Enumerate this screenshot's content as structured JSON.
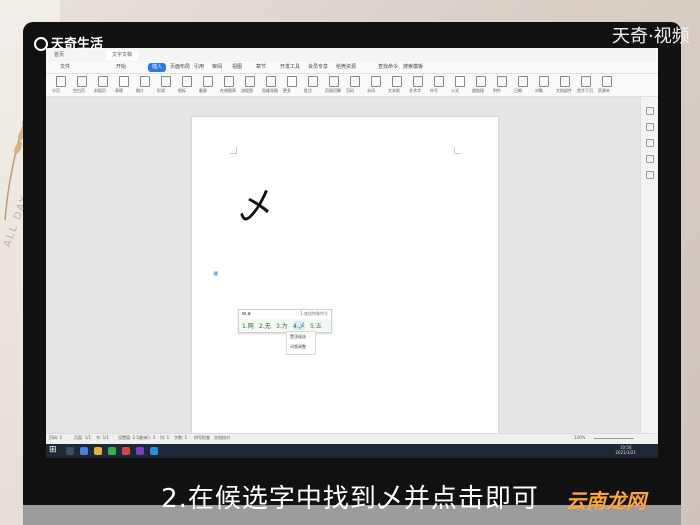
{
  "branding": {
    "top_left": "天奇生活",
    "top_right": "天奇·视频",
    "bottom_right_1": "云南",
    "bottom_right_2": "龙网"
  },
  "background": {
    "side_text": "ALL DAY"
  },
  "subtitle": "2.在候选字中找到乄并点击即可",
  "window": {
    "tabs": [
      "首页",
      "文字文稿"
    ],
    "active_tab": "文字文稿"
  },
  "menu": {
    "items": [
      "文件",
      "开始",
      "插入",
      "页面布局",
      "引用",
      "审阅",
      "视图",
      "章节",
      "开发工具",
      "会员专享",
      "稻壳资源",
      "查找命令、搜索模板"
    ],
    "active": "插入"
  },
  "ribbon": {
    "groups": [
      "分页",
      "空白页",
      "封面页",
      "表格",
      "图片",
      "形状",
      "图标",
      "截屏",
      "在线图表",
      "流程图",
      "思维导图",
      "更多",
      "批注",
      "页眉页脚",
      "页码",
      "水印",
      "文本框",
      "艺术字",
      "符号",
      "公式",
      "超链接",
      "附件",
      "日期",
      "对象",
      "文档部件",
      "首字下沉",
      "资源夹"
    ]
  },
  "document": {
    "glyph": "乄"
  },
  "ime": {
    "input": "w,a",
    "hint": "1.查找特殊符号",
    "candidates": [
      "1.网",
      "2.无",
      "3.为",
      "4.乄",
      "5.五"
    ],
    "selected_index": 3,
    "menu": [
      "置顶候选",
      "词频调整"
    ]
  },
  "statusbar": {
    "page": "页码: 1",
    "pages": "页面: 1/1",
    "section": "节: 1/1",
    "setting": "设置值: 2.5厘米",
    "row": "行: 3",
    "col": "列: 1",
    "words": "字数: 1",
    "spell": "拼写检查",
    "doc_check": "文档校对",
    "zoom": "120%"
  },
  "taskbar": {
    "time": "10:56",
    "date": "2021/3/21"
  }
}
